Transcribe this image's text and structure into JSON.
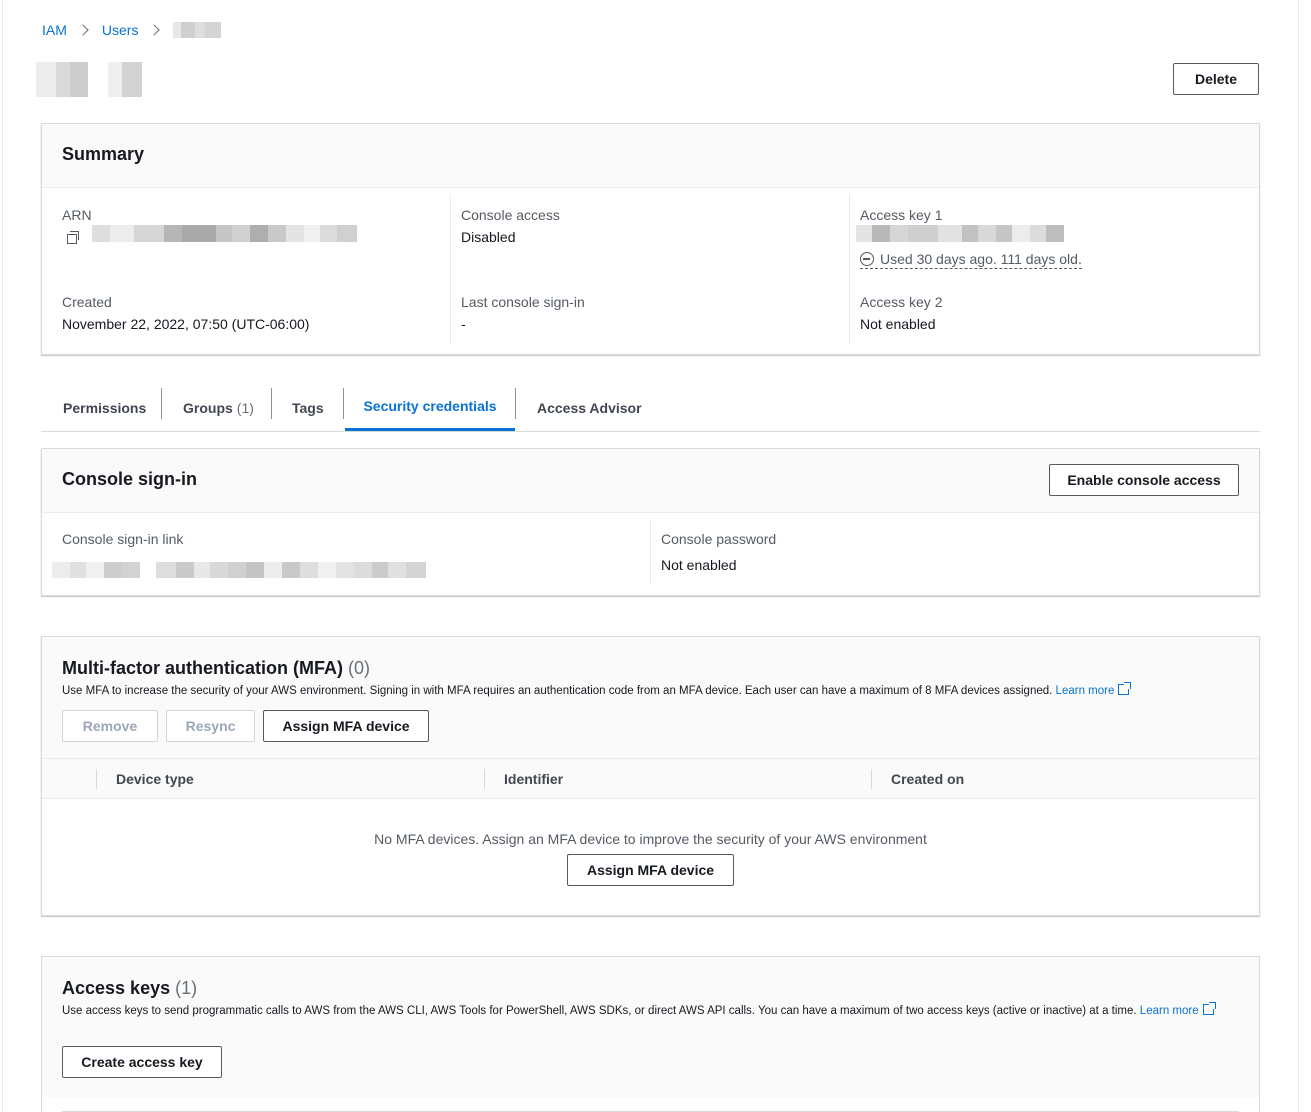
{
  "breadcrumb": {
    "items": [
      "IAM",
      "Users"
    ]
  },
  "header": {
    "delete_label": "Delete"
  },
  "summary": {
    "title": "Summary",
    "arn_label": "ARN",
    "created_label": "Created",
    "created_value": "November 22, 2022, 07:50 (UTC-06:00)",
    "console_access_label": "Console access",
    "console_access_value": "Disabled",
    "last_signin_label": "Last console sign-in",
    "last_signin_value": "-",
    "access_key1_label": "Access key 1",
    "access_key1_status": "Used 30 days ago. 111 days old.",
    "access_key2_label": "Access key 2",
    "access_key2_value": "Not enabled"
  },
  "tabs": {
    "permissions": "Permissions",
    "groups": "Groups",
    "groups_count": "(1)",
    "tags": "Tags",
    "security_credentials": "Security credentials",
    "access_advisor": "Access Advisor",
    "active": "security_credentials"
  },
  "console_signin": {
    "title": "Console sign-in",
    "enable_button": "Enable console access",
    "link_label": "Console sign-in link",
    "password_label": "Console password",
    "password_value": "Not enabled"
  },
  "mfa": {
    "title": "Multi-factor authentication (MFA)",
    "count": "(0)",
    "description": "Use MFA to increase the security of your AWS environment. Signing in with MFA requires an authentication code from an MFA device. Each user can have a maximum of 8 MFA devices assigned.",
    "learn_more": "Learn more",
    "remove_button": "Remove",
    "resync_button": "Resync",
    "assign_button": "Assign MFA device",
    "columns": [
      "Device type",
      "Identifier",
      "Created on"
    ],
    "empty_message": "No MFA devices. Assign an MFA device to improve the security of your AWS environment",
    "empty_assign_button": "Assign MFA device"
  },
  "access_keys": {
    "title": "Access keys",
    "count": "(1)",
    "description_a": "Use access keys to send programmatic calls to AWS from the AWS CLI, AWS Tools for PowerShell, AWS SDKs, or direct AWS API calls. You can have a maximum of two access keys (active or inactive) at a time.",
    "learn": "Learn",
    "more": "more",
    "create_button": "Create access key"
  },
  "colors": {
    "link": "#0972d3",
    "border": "#d5dbdb",
    "header_bg": "#fafafa"
  }
}
